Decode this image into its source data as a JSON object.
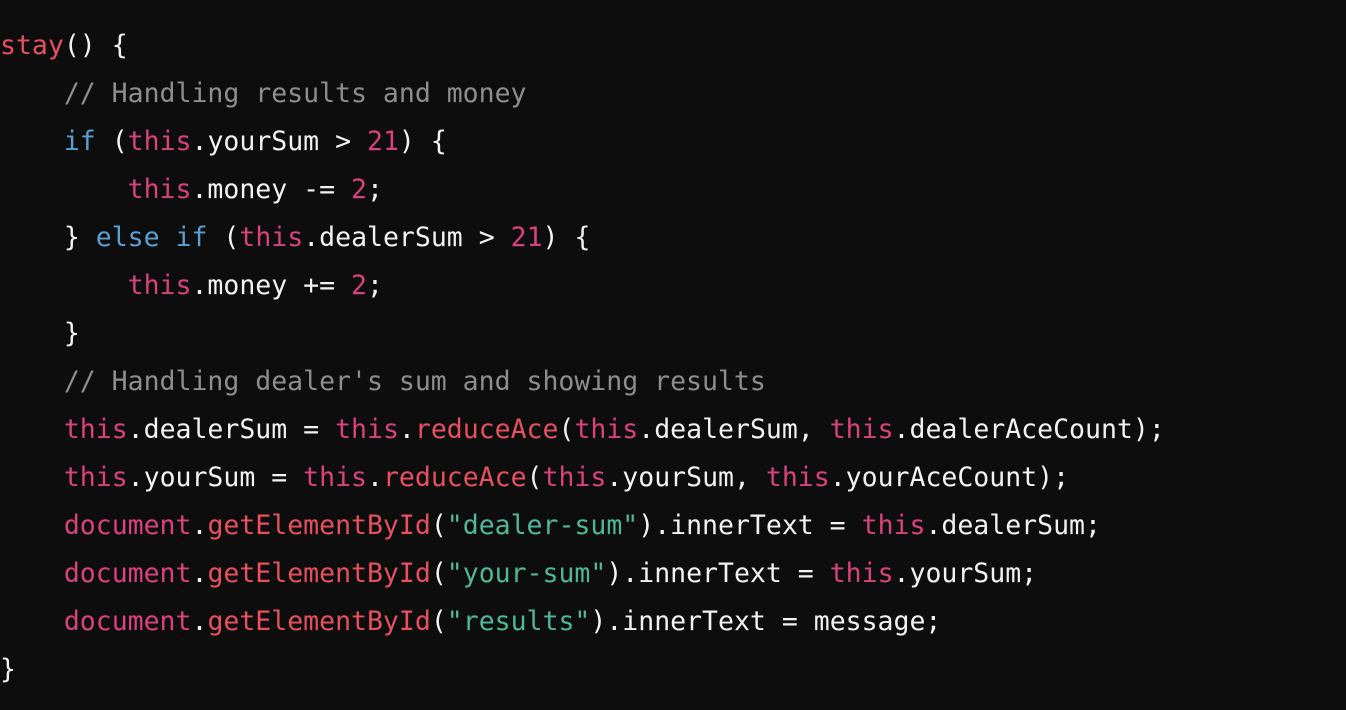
{
  "colors": {
    "background": "#0d0d0d",
    "default": "#f2f2f2",
    "function": "#e6505f",
    "comment": "#8e8e8e",
    "keyword": "#5a9fd4",
    "this_and_numbers": "#d9427d",
    "string": "#4fb89a"
  },
  "code": {
    "lines": [
      [
        {
          "text": "stay",
          "type": "func"
        },
        {
          "text": "() {",
          "type": "default"
        }
      ],
      [
        {
          "text": "    // Handling results and money",
          "type": "comment"
        }
      ],
      [
        {
          "text": "    ",
          "type": "default"
        },
        {
          "text": "if",
          "type": "keyword"
        },
        {
          "text": " (",
          "type": "default"
        },
        {
          "text": "this",
          "type": "this"
        },
        {
          "text": ".yourSum > ",
          "type": "default"
        },
        {
          "text": "21",
          "type": "number"
        },
        {
          "text": ") {",
          "type": "default"
        }
      ],
      [
        {
          "text": "        ",
          "type": "default"
        },
        {
          "text": "this",
          "type": "this"
        },
        {
          "text": ".money -= ",
          "type": "default"
        },
        {
          "text": "2",
          "type": "number"
        },
        {
          "text": ";",
          "type": "default"
        }
      ],
      [
        {
          "text": "    } ",
          "type": "default"
        },
        {
          "text": "else",
          "type": "keyword"
        },
        {
          "text": " ",
          "type": "default"
        },
        {
          "text": "if",
          "type": "keyword"
        },
        {
          "text": " (",
          "type": "default"
        },
        {
          "text": "this",
          "type": "this"
        },
        {
          "text": ".dealerSum > ",
          "type": "default"
        },
        {
          "text": "21",
          "type": "number"
        },
        {
          "text": ") {",
          "type": "default"
        }
      ],
      [
        {
          "text": "        ",
          "type": "default"
        },
        {
          "text": "this",
          "type": "this"
        },
        {
          "text": ".money += ",
          "type": "default"
        },
        {
          "text": "2",
          "type": "number"
        },
        {
          "text": ";",
          "type": "default"
        }
      ],
      [
        {
          "text": "    }",
          "type": "default"
        }
      ],
      [
        {
          "text": "    // Handling dealer's sum and showing results",
          "type": "comment"
        }
      ],
      [
        {
          "text": "    ",
          "type": "default"
        },
        {
          "text": "this",
          "type": "this"
        },
        {
          "text": ".dealerSum = ",
          "type": "default"
        },
        {
          "text": "this",
          "type": "this"
        },
        {
          "text": ".",
          "type": "default"
        },
        {
          "text": "reduceAce",
          "type": "func"
        },
        {
          "text": "(",
          "type": "default"
        },
        {
          "text": "this",
          "type": "this"
        },
        {
          "text": ".dealerSum, ",
          "type": "default"
        },
        {
          "text": "this",
          "type": "this"
        },
        {
          "text": ".dealerAceCount);",
          "type": "default"
        }
      ],
      [
        {
          "text": "    ",
          "type": "default"
        },
        {
          "text": "this",
          "type": "this"
        },
        {
          "text": ".yourSum = ",
          "type": "default"
        },
        {
          "text": "this",
          "type": "this"
        },
        {
          "text": ".",
          "type": "default"
        },
        {
          "text": "reduceAce",
          "type": "func"
        },
        {
          "text": "(",
          "type": "default"
        },
        {
          "text": "this",
          "type": "this"
        },
        {
          "text": ".yourSum, ",
          "type": "default"
        },
        {
          "text": "this",
          "type": "this"
        },
        {
          "text": ".yourAceCount);",
          "type": "default"
        }
      ],
      [
        {
          "text": "    ",
          "type": "default"
        },
        {
          "text": "document",
          "type": "object"
        },
        {
          "text": ".",
          "type": "default"
        },
        {
          "text": "getElementById",
          "type": "func"
        },
        {
          "text": "(",
          "type": "default"
        },
        {
          "text": "\"dealer-sum\"",
          "type": "string"
        },
        {
          "text": ").innerText = ",
          "type": "default"
        },
        {
          "text": "this",
          "type": "this"
        },
        {
          "text": ".dealerSum;",
          "type": "default"
        }
      ],
      [
        {
          "text": "    ",
          "type": "default"
        },
        {
          "text": "document",
          "type": "object"
        },
        {
          "text": ".",
          "type": "default"
        },
        {
          "text": "getElementById",
          "type": "func"
        },
        {
          "text": "(",
          "type": "default"
        },
        {
          "text": "\"your-sum\"",
          "type": "string"
        },
        {
          "text": ").innerText = ",
          "type": "default"
        },
        {
          "text": "this",
          "type": "this"
        },
        {
          "text": ".yourSum;",
          "type": "default"
        }
      ],
      [
        {
          "text": "    ",
          "type": "default"
        },
        {
          "text": "document",
          "type": "object"
        },
        {
          "text": ".",
          "type": "default"
        },
        {
          "text": "getElementById",
          "type": "func"
        },
        {
          "text": "(",
          "type": "default"
        },
        {
          "text": "\"results\"",
          "type": "string"
        },
        {
          "text": ").innerText = message;",
          "type": "default"
        }
      ],
      [
        {
          "text": "}",
          "type": "default"
        }
      ]
    ]
  }
}
